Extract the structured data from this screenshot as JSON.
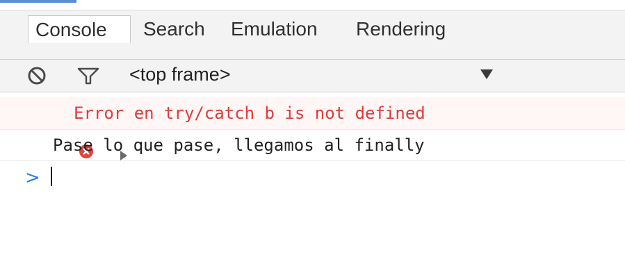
{
  "tabs": [
    {
      "label": "Console",
      "active": true
    },
    {
      "label": "Search",
      "active": false
    },
    {
      "label": "Emulation",
      "active": false
    },
    {
      "label": "Rendering",
      "active": false
    }
  ],
  "toolbar": {
    "clear_icon": "no-entry-icon",
    "filter_icon": "funnel-icon",
    "frame_selector_value": "<top frame>",
    "dropdown_icon": "triangle-down-icon"
  },
  "console": {
    "messages": [
      {
        "type": "error",
        "icon": "error-circle-icon",
        "expandable": true,
        "text": "Error en try/catch b is not defined"
      },
      {
        "type": "log",
        "text": "Pase lo que pase, llegamos al finally"
      }
    ],
    "prompt_symbol": ">",
    "input_value": ""
  },
  "colors": {
    "error_text": "#e13a3a",
    "prompt": "#2f7ae5",
    "tab_bar_bg": "#f3f3f3",
    "accent": "#5a8fd6"
  }
}
